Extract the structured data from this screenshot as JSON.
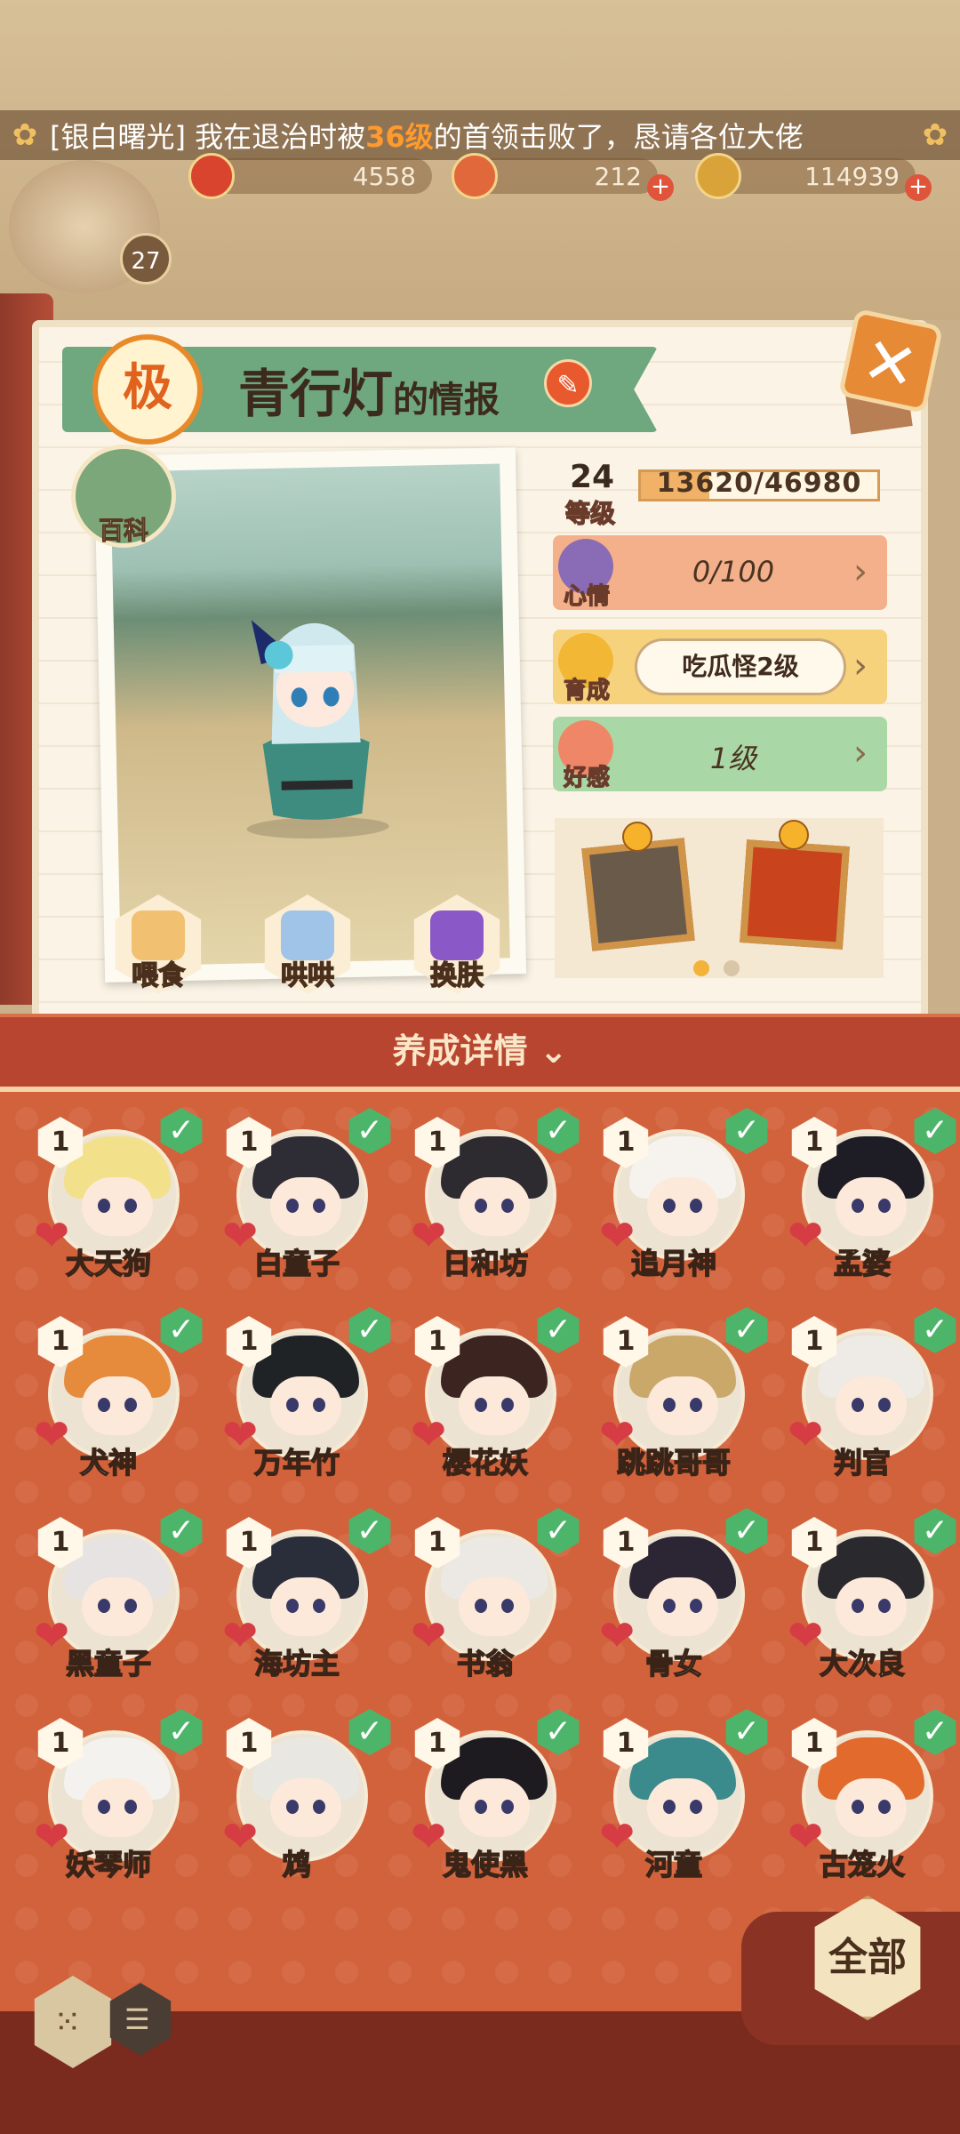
{
  "marquee": {
    "prefix": "[银白曙光] 我在退治时被",
    "highlight": "36级",
    "suffix": "的首领击败了，恳请各位大佬"
  },
  "resources": {
    "gem": "4558",
    "stamina": "212",
    "coins": "114939"
  },
  "player": {
    "level": "27"
  },
  "info": {
    "grade": "极",
    "name": "青行灯",
    "name_suffix": "的情报",
    "baike_label": "百科",
    "level": "24",
    "level_label": "等级",
    "exp_text": "13620/46980",
    "exp_fraction": 0.29,
    "mood_label": "心情",
    "mood_value": "0/100",
    "grow_label": "育成",
    "grow_value": "吃瓜怪2级",
    "affection_label": "好感",
    "affection_value": "1级",
    "actions": [
      "喂食",
      "哄哄",
      "换肤"
    ]
  },
  "detail_title": "养成详情",
  "characters": [
    {
      "name": "大天狗",
      "level": "1",
      "hair": "#f3e08a"
    },
    {
      "name": "白童子",
      "level": "1",
      "hair": "#2e2c35"
    },
    {
      "name": "日和坊",
      "level": "1",
      "hair": "#2d2a30"
    },
    {
      "name": "追月神",
      "level": "1",
      "hair": "#f6f3ef"
    },
    {
      "name": "孟婆",
      "level": "1",
      "hair": "#1e1c24"
    },
    {
      "name": "犬神",
      "level": "1",
      "hair": "#e68a3c"
    },
    {
      "name": "万年竹",
      "level": "1",
      "hair": "#1f2326"
    },
    {
      "name": "樱花妖",
      "level": "1",
      "hair": "#3c2420"
    },
    {
      "name": "跳跳哥哥",
      "level": "1",
      "hair": "#c9a86a"
    },
    {
      "name": "判官",
      "level": "1",
      "hair": "#eeeae6"
    },
    {
      "name": "黑童子",
      "level": "1",
      "hair": "#e7e3e2"
    },
    {
      "name": "海坊主",
      "level": "1",
      "hair": "#2a2d3a"
    },
    {
      "name": "书翁",
      "level": "1",
      "hair": "#ece9e5"
    },
    {
      "name": "骨女",
      "level": "1",
      "hair": "#2c2634"
    },
    {
      "name": "大次良",
      "level": "1",
      "hair": "#2a2a2e"
    },
    {
      "name": "妖琴师",
      "level": "1",
      "hair": "#f4f2ef"
    },
    {
      "name": "鸩",
      "level": "1",
      "hair": "#e9e7e2"
    },
    {
      "name": "鬼使黑",
      "level": "1",
      "hair": "#1d1b20"
    },
    {
      "name": "河童",
      "level": "1",
      "hair": "#3b8a8c"
    },
    {
      "name": "古笼火",
      "level": "1",
      "hair": "#e16a2c"
    }
  ],
  "all_button": "全部",
  "colors": {
    "accent": "#d2623c",
    "check": "#4db56a",
    "banner": "#6fa77e"
  }
}
